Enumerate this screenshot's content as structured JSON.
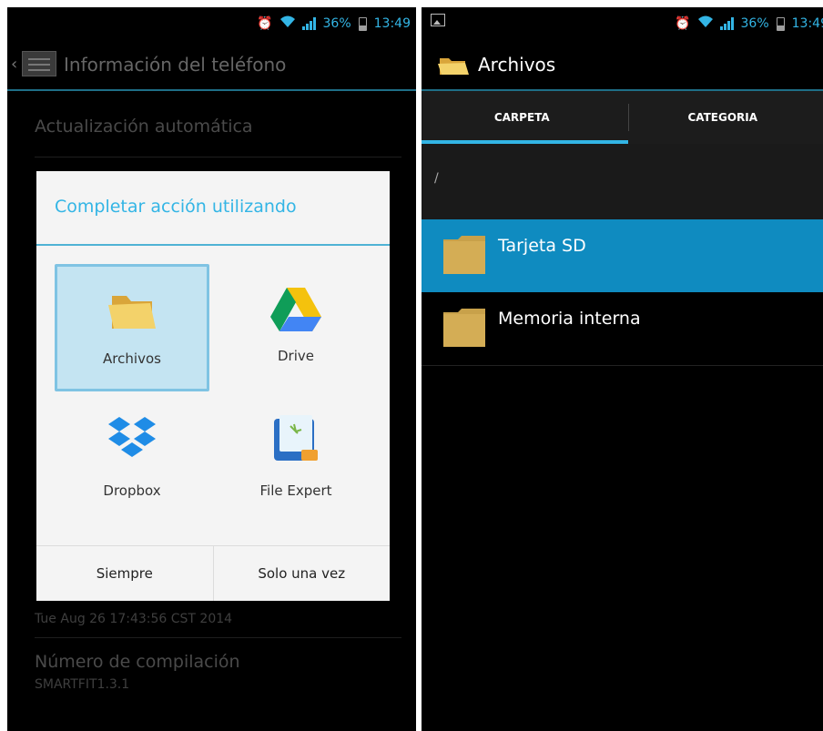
{
  "status_bar": {
    "battery": "36%",
    "time": "13:49"
  },
  "left_screen": {
    "action_bar_title": "Información del teléfono",
    "background_items": {
      "auto_update": "Actualización automática",
      "build_date": "Tue Aug 26 17:43:56 CST 2014",
      "build_number_title": "Número de compilación",
      "build_number_value": "SMARTFIT1.3.1"
    },
    "dialog": {
      "title": "Completar acción utilizando",
      "apps": [
        {
          "label": "Archivos",
          "icon": "folder-icon",
          "selected": true
        },
        {
          "label": "Drive",
          "icon": "drive-icon",
          "selected": false
        },
        {
          "label": "Dropbox",
          "icon": "dropbox-icon",
          "selected": false
        },
        {
          "label": "File Expert",
          "icon": "file-expert-icon",
          "selected": false
        }
      ],
      "buttons": {
        "always": "Siempre",
        "once": "Solo una vez"
      }
    }
  },
  "right_screen": {
    "action_bar_title": "Archivos",
    "tabs": [
      {
        "label": "CARPETA",
        "active": true
      },
      {
        "label": "CATEGORIA",
        "active": false
      }
    ],
    "path": "/",
    "items": [
      {
        "name": "Tarjeta SD",
        "selected": true
      },
      {
        "name": "Memoria interna",
        "selected": false
      }
    ]
  },
  "colors": {
    "accent": "#33b5e5",
    "selection_blue": "#0f8bc0",
    "dialog_bg": "#f4f4f4",
    "folder": "#c8a14a"
  }
}
